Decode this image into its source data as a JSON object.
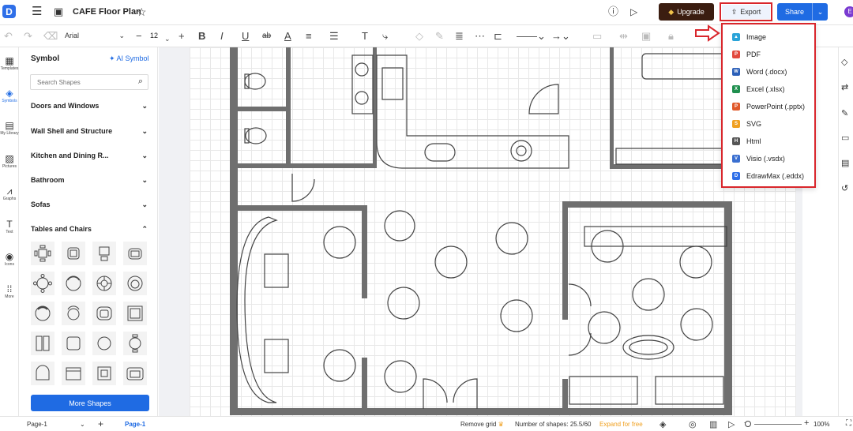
{
  "app": {
    "logo_letter": "D",
    "title": "CAFE Floor Plan"
  },
  "header": {
    "upgrade_label": "Upgrade",
    "export_label": "Export",
    "share_label": "Share",
    "avatar_letter": "E"
  },
  "toolbar": {
    "font_name": "Arial",
    "font_size": "12"
  },
  "left_rail": {
    "items": [
      {
        "label": "Templates",
        "icon": "templates-icon"
      },
      {
        "label": "Symbols",
        "icon": "symbols-icon"
      },
      {
        "label": "My Library",
        "icon": "library-icon"
      },
      {
        "label": "Pictures",
        "icon": "pictures-icon"
      },
      {
        "label": "Graphs",
        "icon": "graphs-icon"
      },
      {
        "label": "Text",
        "icon": "text-icon"
      },
      {
        "label": "Icons",
        "icon": "icons-icon"
      },
      {
        "label": "More",
        "icon": "more-icon"
      }
    ]
  },
  "panel": {
    "title": "Symbol",
    "ai_symbol": "AI Symbol",
    "search_placeholder": "Search Shapes",
    "categories": [
      {
        "label": "Doors and Windows",
        "expanded": false
      },
      {
        "label": "Wall Shell and Structure",
        "expanded": false
      },
      {
        "label": "Kitchen and Dining R...",
        "expanded": false
      },
      {
        "label": "Bathroom",
        "expanded": false
      },
      {
        "label": "Sofas",
        "expanded": false
      },
      {
        "label": "Tables and Chairs",
        "expanded": true
      }
    ],
    "more_shapes": "More Shapes"
  },
  "export_menu": {
    "items": [
      {
        "label": "Image",
        "icon": "image-icon",
        "color": "#2aa3d8"
      },
      {
        "label": "PDF",
        "icon": "pdf-icon",
        "color": "#e2483d"
      },
      {
        "label": "Word (.docx)",
        "icon": "word-icon",
        "color": "#2b5fb8"
      },
      {
        "label": "Excel (.xlsx)",
        "icon": "excel-icon",
        "color": "#1f8f4e"
      },
      {
        "label": "PowerPoint (.pptx)",
        "icon": "powerpoint-icon",
        "color": "#e0592a"
      },
      {
        "label": "SVG",
        "icon": "svg-icon",
        "color": "#f0a020"
      },
      {
        "label": "Html",
        "icon": "html-icon",
        "color": "#555555"
      },
      {
        "label": "Visio (.vsdx)",
        "icon": "visio-icon",
        "color": "#3a6fd0"
      },
      {
        "label": "EdrawMax (.eddx)",
        "icon": "edrawmax-icon",
        "color": "#2f6fe8"
      }
    ]
  },
  "status": {
    "page_select": "Page-1",
    "page_tab": "Page-1",
    "remove_grid": "Remove grid",
    "shapes_count": "Number of shapes: 25.5/60",
    "expand": "Expand for free",
    "zoom": "100%"
  },
  "colors": {
    "accent": "#1f6be3",
    "highlight": "#d9262c",
    "upgrade_bg": "#3b1d10",
    "wall": "#6f6f6f"
  }
}
